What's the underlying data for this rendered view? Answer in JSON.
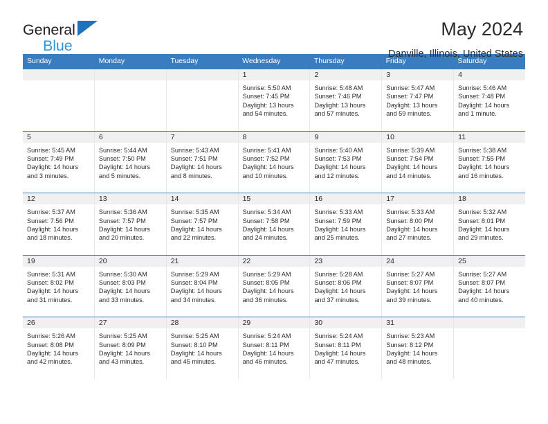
{
  "brand": {
    "line1": "General",
    "line2": "Blue",
    "triangle_color": "#1f73bc",
    "blue_text_color": "#2e96da"
  },
  "header": {
    "title": "May 2024",
    "subtitle": "Danville, Illinois, United States"
  },
  "theme": {
    "header_blue": "#3a7cc0",
    "daynum_band": "#f0f0f0",
    "grid_line": "#e7e7e7",
    "text": "#2a2a2a"
  },
  "weekdays": [
    "Sunday",
    "Monday",
    "Tuesday",
    "Wednesday",
    "Thursday",
    "Friday",
    "Saturday"
  ],
  "weeks": [
    [
      {
        "day": "",
        "empty": true,
        "sunrise": "",
        "sunset": "",
        "daylight1": "",
        "daylight2": ""
      },
      {
        "day": "",
        "empty": true,
        "sunrise": "",
        "sunset": "",
        "daylight1": "",
        "daylight2": ""
      },
      {
        "day": "",
        "empty": true,
        "sunrise": "",
        "sunset": "",
        "daylight1": "",
        "daylight2": ""
      },
      {
        "day": "1",
        "sunrise": "Sunrise: 5:50 AM",
        "sunset": "Sunset: 7:45 PM",
        "daylight1": "Daylight: 13 hours",
        "daylight2": "and 54 minutes."
      },
      {
        "day": "2",
        "sunrise": "Sunrise: 5:48 AM",
        "sunset": "Sunset: 7:46 PM",
        "daylight1": "Daylight: 13 hours",
        "daylight2": "and 57 minutes."
      },
      {
        "day": "3",
        "sunrise": "Sunrise: 5:47 AM",
        "sunset": "Sunset: 7:47 PM",
        "daylight1": "Daylight: 13 hours",
        "daylight2": "and 59 minutes."
      },
      {
        "day": "4",
        "sunrise": "Sunrise: 5:46 AM",
        "sunset": "Sunset: 7:48 PM",
        "daylight1": "Daylight: 14 hours",
        "daylight2": "and 1 minute."
      }
    ],
    [
      {
        "day": "5",
        "sunrise": "Sunrise: 5:45 AM",
        "sunset": "Sunset: 7:49 PM",
        "daylight1": "Daylight: 14 hours",
        "daylight2": "and 3 minutes."
      },
      {
        "day": "6",
        "sunrise": "Sunrise: 5:44 AM",
        "sunset": "Sunset: 7:50 PM",
        "daylight1": "Daylight: 14 hours",
        "daylight2": "and 5 minutes."
      },
      {
        "day": "7",
        "sunrise": "Sunrise: 5:43 AM",
        "sunset": "Sunset: 7:51 PM",
        "daylight1": "Daylight: 14 hours",
        "daylight2": "and 8 minutes."
      },
      {
        "day": "8",
        "sunrise": "Sunrise: 5:41 AM",
        "sunset": "Sunset: 7:52 PM",
        "daylight1": "Daylight: 14 hours",
        "daylight2": "and 10 minutes."
      },
      {
        "day": "9",
        "sunrise": "Sunrise: 5:40 AM",
        "sunset": "Sunset: 7:53 PM",
        "daylight1": "Daylight: 14 hours",
        "daylight2": "and 12 minutes."
      },
      {
        "day": "10",
        "sunrise": "Sunrise: 5:39 AM",
        "sunset": "Sunset: 7:54 PM",
        "daylight1": "Daylight: 14 hours",
        "daylight2": "and 14 minutes."
      },
      {
        "day": "11",
        "sunrise": "Sunrise: 5:38 AM",
        "sunset": "Sunset: 7:55 PM",
        "daylight1": "Daylight: 14 hours",
        "daylight2": "and 16 minutes."
      }
    ],
    [
      {
        "day": "12",
        "sunrise": "Sunrise: 5:37 AM",
        "sunset": "Sunset: 7:56 PM",
        "daylight1": "Daylight: 14 hours",
        "daylight2": "and 18 minutes."
      },
      {
        "day": "13",
        "sunrise": "Sunrise: 5:36 AM",
        "sunset": "Sunset: 7:57 PM",
        "daylight1": "Daylight: 14 hours",
        "daylight2": "and 20 minutes."
      },
      {
        "day": "14",
        "sunrise": "Sunrise: 5:35 AM",
        "sunset": "Sunset: 7:57 PM",
        "daylight1": "Daylight: 14 hours",
        "daylight2": "and 22 minutes."
      },
      {
        "day": "15",
        "sunrise": "Sunrise: 5:34 AM",
        "sunset": "Sunset: 7:58 PM",
        "daylight1": "Daylight: 14 hours",
        "daylight2": "and 24 minutes."
      },
      {
        "day": "16",
        "sunrise": "Sunrise: 5:33 AM",
        "sunset": "Sunset: 7:59 PM",
        "daylight1": "Daylight: 14 hours",
        "daylight2": "and 25 minutes."
      },
      {
        "day": "17",
        "sunrise": "Sunrise: 5:33 AM",
        "sunset": "Sunset: 8:00 PM",
        "daylight1": "Daylight: 14 hours",
        "daylight2": "and 27 minutes."
      },
      {
        "day": "18",
        "sunrise": "Sunrise: 5:32 AM",
        "sunset": "Sunset: 8:01 PM",
        "daylight1": "Daylight: 14 hours",
        "daylight2": "and 29 minutes."
      }
    ],
    [
      {
        "day": "19",
        "sunrise": "Sunrise: 5:31 AM",
        "sunset": "Sunset: 8:02 PM",
        "daylight1": "Daylight: 14 hours",
        "daylight2": "and 31 minutes."
      },
      {
        "day": "20",
        "sunrise": "Sunrise: 5:30 AM",
        "sunset": "Sunset: 8:03 PM",
        "daylight1": "Daylight: 14 hours",
        "daylight2": "and 33 minutes."
      },
      {
        "day": "21",
        "sunrise": "Sunrise: 5:29 AM",
        "sunset": "Sunset: 8:04 PM",
        "daylight1": "Daylight: 14 hours",
        "daylight2": "and 34 minutes."
      },
      {
        "day": "22",
        "sunrise": "Sunrise: 5:29 AM",
        "sunset": "Sunset: 8:05 PM",
        "daylight1": "Daylight: 14 hours",
        "daylight2": "and 36 minutes."
      },
      {
        "day": "23",
        "sunrise": "Sunrise: 5:28 AM",
        "sunset": "Sunset: 8:06 PM",
        "daylight1": "Daylight: 14 hours",
        "daylight2": "and 37 minutes."
      },
      {
        "day": "24",
        "sunrise": "Sunrise: 5:27 AM",
        "sunset": "Sunset: 8:07 PM",
        "daylight1": "Daylight: 14 hours",
        "daylight2": "and 39 minutes."
      },
      {
        "day": "25",
        "sunrise": "Sunrise: 5:27 AM",
        "sunset": "Sunset: 8:07 PM",
        "daylight1": "Daylight: 14 hours",
        "daylight2": "and 40 minutes."
      }
    ],
    [
      {
        "day": "26",
        "sunrise": "Sunrise: 5:26 AM",
        "sunset": "Sunset: 8:08 PM",
        "daylight1": "Daylight: 14 hours",
        "daylight2": "and 42 minutes."
      },
      {
        "day": "27",
        "sunrise": "Sunrise: 5:25 AM",
        "sunset": "Sunset: 8:09 PM",
        "daylight1": "Daylight: 14 hours",
        "daylight2": "and 43 minutes."
      },
      {
        "day": "28",
        "sunrise": "Sunrise: 5:25 AM",
        "sunset": "Sunset: 8:10 PM",
        "daylight1": "Daylight: 14 hours",
        "daylight2": "and 45 minutes."
      },
      {
        "day": "29",
        "sunrise": "Sunrise: 5:24 AM",
        "sunset": "Sunset: 8:11 PM",
        "daylight1": "Daylight: 14 hours",
        "daylight2": "and 46 minutes."
      },
      {
        "day": "30",
        "sunrise": "Sunrise: 5:24 AM",
        "sunset": "Sunset: 8:11 PM",
        "daylight1": "Daylight: 14 hours",
        "daylight2": "and 47 minutes."
      },
      {
        "day": "31",
        "sunrise": "Sunrise: 5:23 AM",
        "sunset": "Sunset: 8:12 PM",
        "daylight1": "Daylight: 14 hours",
        "daylight2": "and 48 minutes."
      },
      {
        "day": "",
        "empty": true,
        "sunrise": "",
        "sunset": "",
        "daylight1": "",
        "daylight2": ""
      }
    ]
  ]
}
